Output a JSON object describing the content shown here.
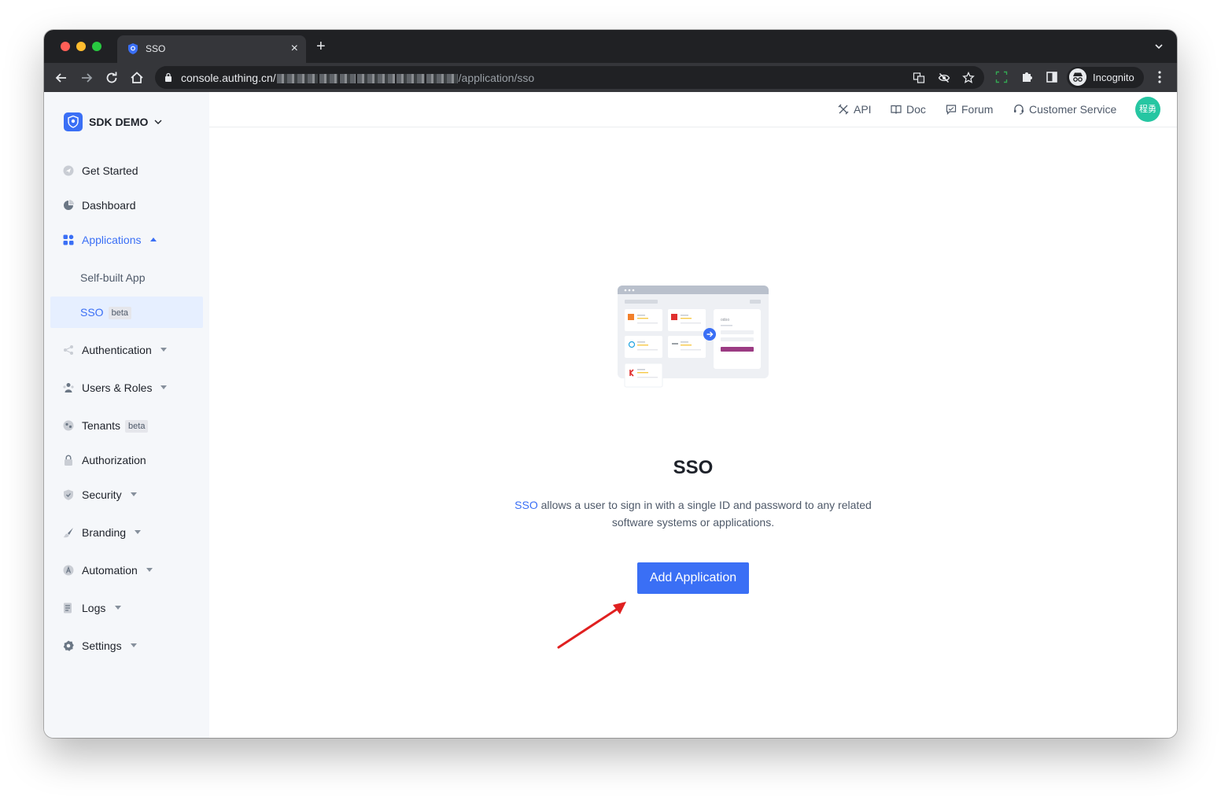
{
  "browser": {
    "tab_title": "SSO",
    "tab_close": "×",
    "new_tab": "+",
    "url_host": "console.authing.cn/",
    "url_path": "/application/sso",
    "incognito_label": "Incognito"
  },
  "sidebar": {
    "brand": "SDK DEMO",
    "items": [
      {
        "label": "Get Started",
        "icon": "paper-plane-icon"
      },
      {
        "label": "Dashboard",
        "icon": "pie-chart-icon"
      },
      {
        "label": "Applications",
        "icon": "apps-grid-icon",
        "expanded": true
      },
      {
        "label": "Self-built App"
      },
      {
        "label": "SSO",
        "badge": "beta",
        "selected": true
      },
      {
        "label": "Authentication",
        "icon": "share-nodes-icon"
      },
      {
        "label": "Users & Roles",
        "icon": "users-icon"
      },
      {
        "label": "Tenants",
        "badge": "beta",
        "icon": "tenants-icon"
      },
      {
        "label": "Authorization",
        "icon": "lock-icon"
      },
      {
        "label": "Security",
        "icon": "shield-icon"
      },
      {
        "label": "Branding",
        "icon": "brush-icon"
      },
      {
        "label": "Automation",
        "icon": "automation-icon"
      },
      {
        "label": "Logs",
        "icon": "logs-icon"
      },
      {
        "label": "Settings",
        "icon": "gear-icon"
      }
    ]
  },
  "topbar": {
    "api": "API",
    "doc": "Doc",
    "forum": "Forum",
    "customer_service": "Customer Service",
    "avatar_text": "程勇"
  },
  "empty_state": {
    "title": "SSO",
    "desc_link": "SSO",
    "desc_text": " allows a user to sign in with a single ID and password to any related software systems or applications.",
    "button": "Add Application",
    "illustration_label": "odoo"
  },
  "colors": {
    "accent": "#3a6ff5",
    "sidebar_bg": "#f5f7fa",
    "selected_bg": "#e6efff",
    "avatar_bg": "#26c6a2",
    "annotation_arrow": "#e02020"
  }
}
